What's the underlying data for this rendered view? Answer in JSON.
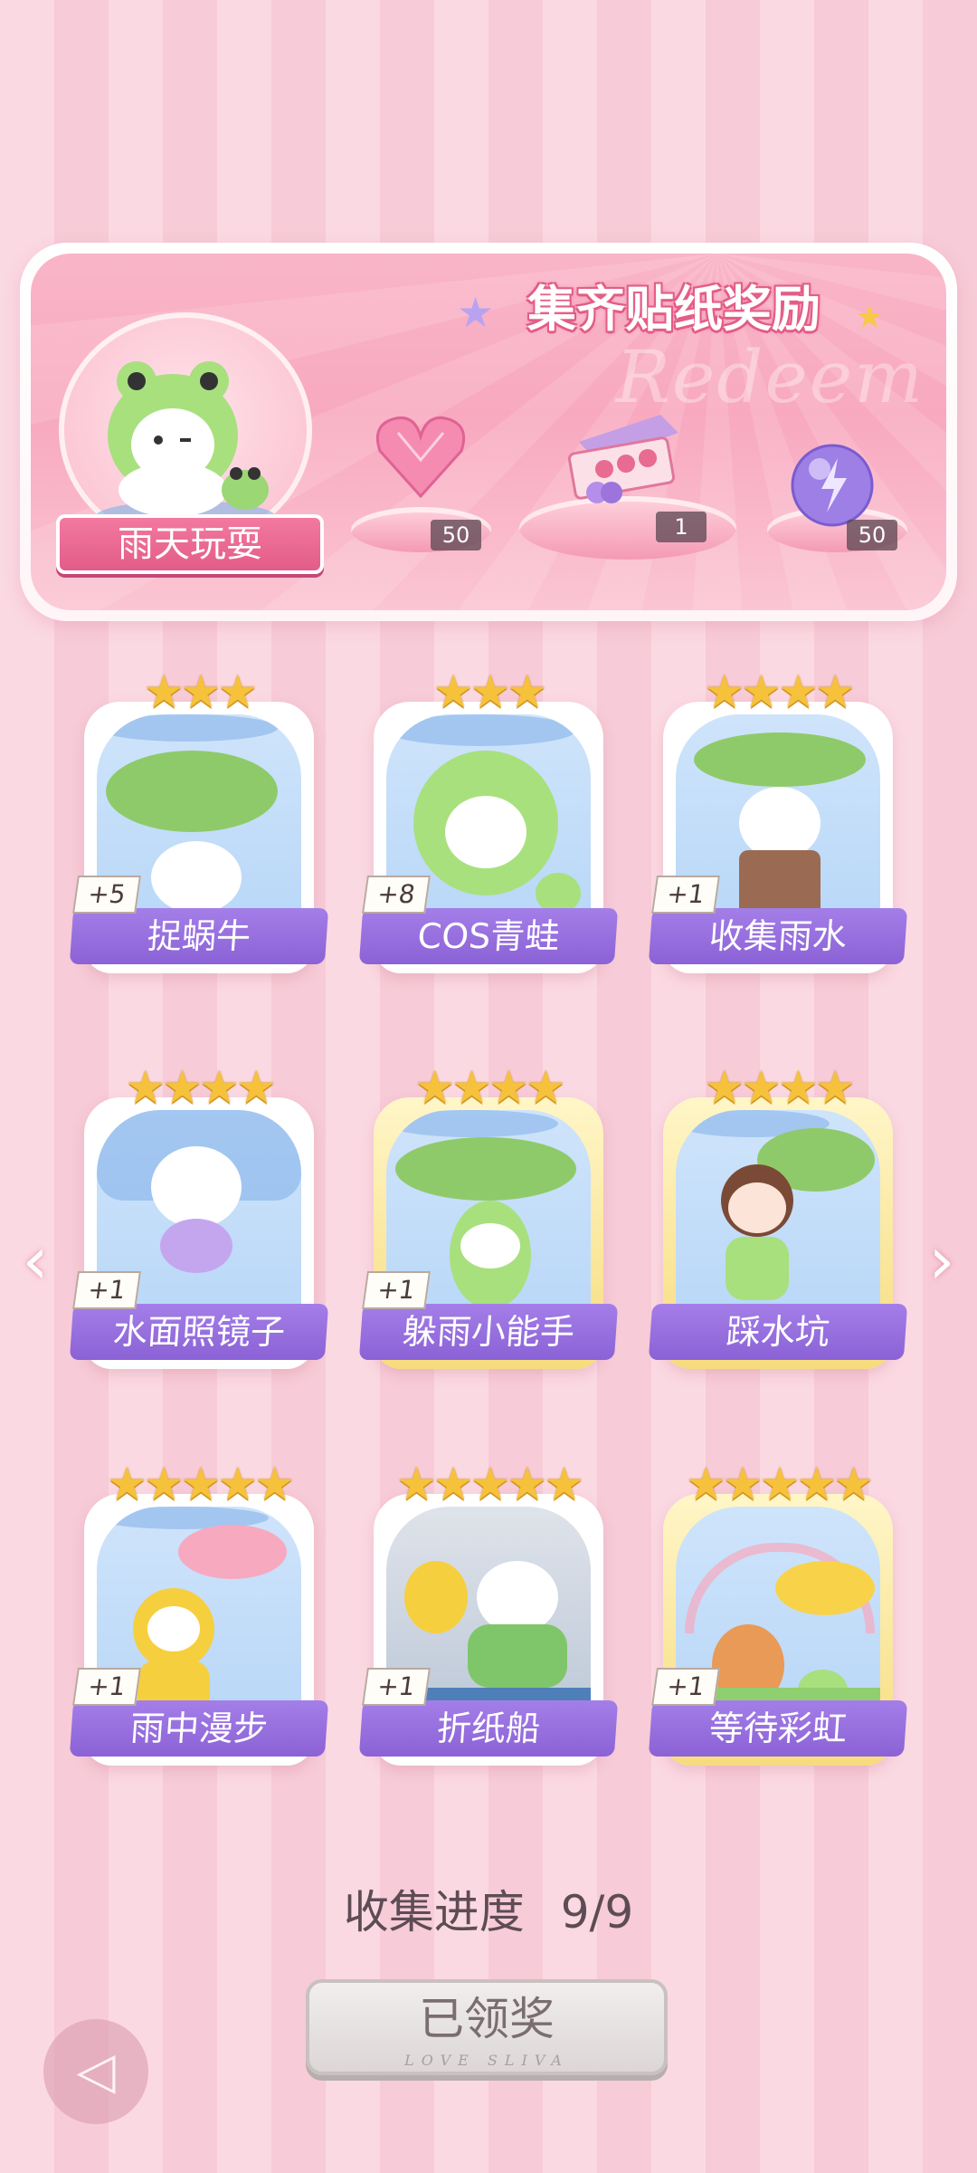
{
  "banner": {
    "title": "集齐贴纸奖励",
    "watermark": "Redeem",
    "theme_label": "雨天玩耍",
    "rewards": [
      {
        "icon": "pink-heart-gem-icon",
        "count": "50"
      },
      {
        "icon": "gift-box-icon",
        "count": "1"
      },
      {
        "icon": "purple-lightning-orb-icon",
        "count": "50"
      }
    ]
  },
  "cards": [
    {
      "name": "捉蜗牛",
      "plus": "+5",
      "stars": "★★★",
      "star_count": 3
    },
    {
      "name": "COS青蛙",
      "plus": "+8",
      "stars": "★★★",
      "star_count": 3
    },
    {
      "name": "收集雨水",
      "plus": "+1",
      "stars": "★★★★",
      "star_count": 4
    },
    {
      "name": "水面照镜子",
      "plus": "+1",
      "stars": "★★★★",
      "star_count": 4
    },
    {
      "name": "躲雨小能手",
      "plus": "+1",
      "stars": "★★★★",
      "star_count": 4
    },
    {
      "name": "踩水坑",
      "plus": "+1",
      "stars": "★★★★",
      "star_count": 4
    },
    {
      "name": "雨中漫步",
      "plus": "+1",
      "stars": "★★★★★",
      "star_count": 5
    },
    {
      "name": "折纸船",
      "plus": "+1",
      "stars": "★★★★★",
      "star_count": 5
    },
    {
      "name": "等待彩虹",
      "plus": "+1",
      "stars": "★★★★★",
      "star_count": 5
    }
  ],
  "nav": {
    "prev": "‹",
    "next": "›"
  },
  "progress": {
    "label": "收集进度",
    "value": "9/9"
  },
  "claim_button": {
    "label": "已领奖",
    "sub": "LOVE SLIVA"
  },
  "back_button": {
    "icon": "back-arrow-icon",
    "glyph": "◁"
  },
  "colors": {
    "accent_pink": "#e35c88",
    "card_label_purple": "#8b62d6",
    "star_gold": "#f6c23b"
  }
}
